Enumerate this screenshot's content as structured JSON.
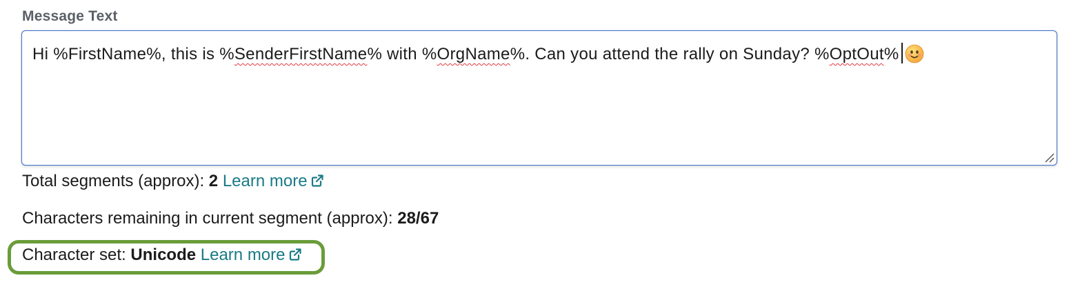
{
  "field": {
    "label": "Message Text"
  },
  "message": {
    "part1": "Hi %FirstName%, this is %",
    "token1": "SenderFirstName",
    "part2": "% with %",
    "token2": "OrgName",
    "part3": "%. Can you attend the rally on Sunday? %",
    "token3": "OptOut",
    "part4": "%",
    "emoji_icon": "slightly-smiling-face-icon"
  },
  "segments": {
    "label": "Total segments (approx):",
    "value": "2",
    "link": "Learn more",
    "link_icon": "external-link-icon"
  },
  "remaining": {
    "label": "Characters remaining in current segment (approx):",
    "value": "28/67"
  },
  "charset": {
    "label": "Character set:",
    "value": "Unicode",
    "link": "Learn more",
    "link_icon": "external-link-icon",
    "highlight_color": "#6a9c3a"
  },
  "colors": {
    "link": "#1a7a86",
    "field_border": "#4a76c6",
    "label": "#5b5f66"
  }
}
